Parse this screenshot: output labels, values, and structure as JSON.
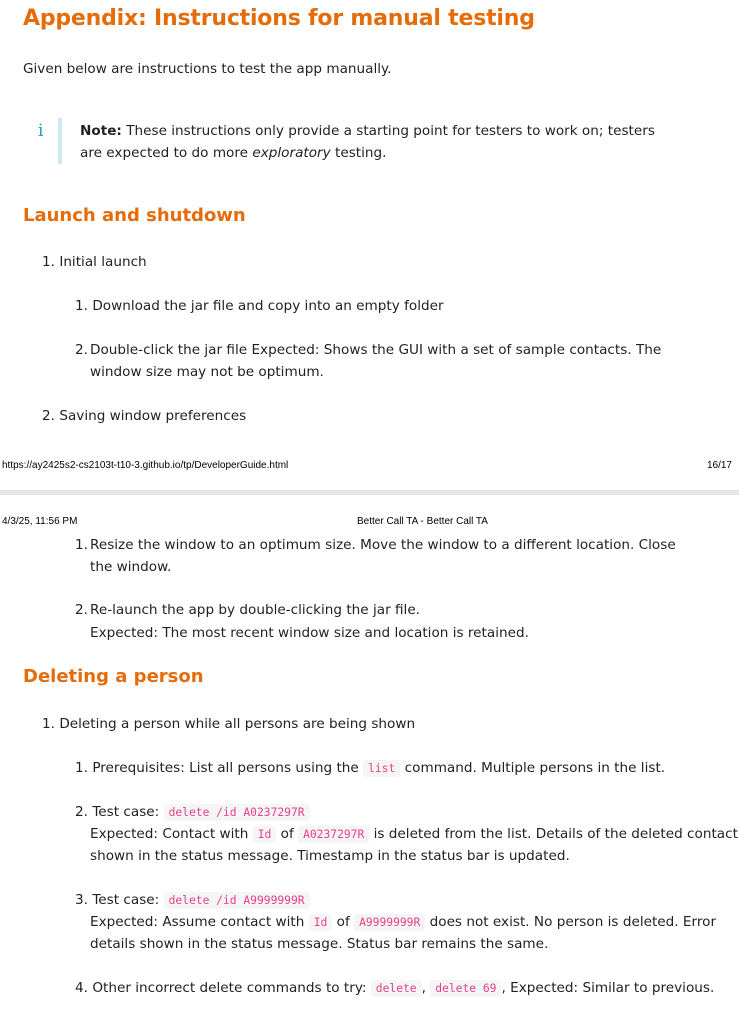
{
  "title": "Appendix: Instructions for manual testing",
  "intro": "Given below are instructions to test the app manually.",
  "note": {
    "icon": "info-icon",
    "icon_glyph": "i",
    "label": "Note:",
    "text_a": "These instructions only provide a starting point for testers to work on; testers are expected to do more",
    "text_em": "exploratory",
    "text_b": "testing."
  },
  "launch": {
    "heading": "Launch and shutdown",
    "item1_num": "1.",
    "item1": "Initial launch",
    "sub1_num": "1.",
    "sub1": "Download the jar file and copy into an empty folder",
    "sub2_num": "2.",
    "sub2": "Double-click the jar file Expected: Shows the GUI with a set of sample contacts. The window size may not be optimum.",
    "item2_num": "2.",
    "item2": "Saving window preferences"
  },
  "footer": {
    "url": "https://ay2425s2-cs2103t-t10-3.github.io/tp/DeveloperGuide.html",
    "page": "16/17"
  },
  "header": {
    "datetime": "4/3/25, 11:56 PM",
    "doc_title": "Better Call TA - Better Call TA"
  },
  "window": {
    "sub1_num": "1.",
    "sub1": "Resize the window to an optimum size. Move the window to a different location. Close the window.",
    "sub2_num": "2.",
    "sub2_a": "Re-launch the app by double-clicking the jar file.",
    "sub2_b": "Expected: The most recent window size and location is retained."
  },
  "deleting": {
    "heading": "Deleting a person",
    "item1_num": "1.",
    "item1": "Deleting a person while all persons are being shown",
    "s1_num": "1.",
    "s1_a": "Prerequisites: List all persons using the",
    "s1_code": "list",
    "s1_b": "command. Multiple persons in the list.",
    "s2_num": "2.",
    "s2_label": "Test case:",
    "s2_code": "delete /id A0237297R",
    "s2_e1": "Expected: Contact with",
    "s2_id": "Id",
    "s2_of": "of",
    "s2_val": "A0237297R",
    "s2_e2": "is deleted from the list. Details of the deleted contact",
    "s2_e3": "shown in the status message. Timestamp in the status bar is updated.",
    "s3_num": "3.",
    "s3_label": "Test case:",
    "s3_code": "delete /id A9999999R",
    "s3_e1": "Expected: Assume contact with",
    "s3_id": "Id",
    "s3_of": "of",
    "s3_val": "A9999999R",
    "s3_e2": "does not exist. No person is deleted. Error",
    "s3_e3": "details shown in the status message. Status bar remains the same.",
    "s4_num": "4.",
    "s4_a": "Other incorrect delete commands to try:",
    "s4_code1": "delete",
    "s4_sep": ",",
    "s4_code2": "delete 69",
    "s4_b": ", Expected: Similar to previous."
  }
}
